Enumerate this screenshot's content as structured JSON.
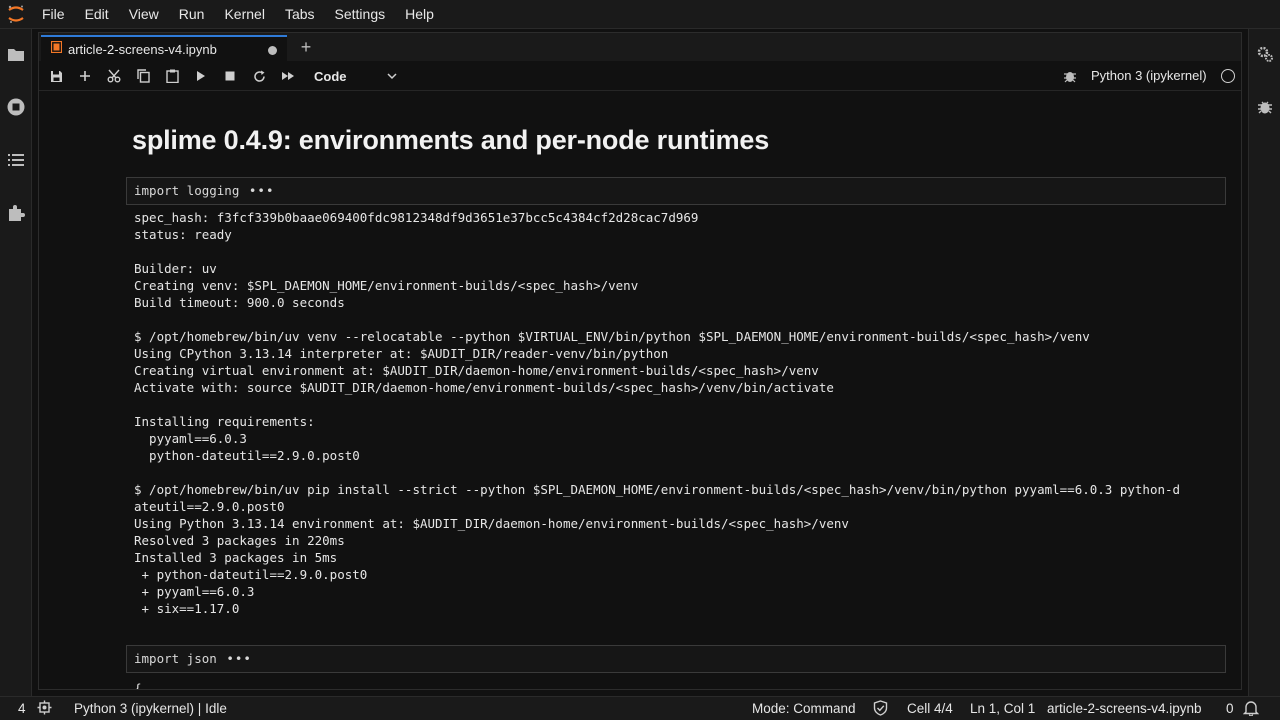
{
  "menu": [
    "File",
    "Edit",
    "View",
    "Run",
    "Kernel",
    "Tabs",
    "Settings",
    "Help"
  ],
  "tab": {
    "label": "article-2-screens-v4.ipynb",
    "add": "+"
  },
  "toolbar": {
    "cell_type": "Code",
    "kernel": "Python 3 (ipykernel)"
  },
  "notebook": {
    "heading": "splime 0.4.9: environments and per-node runtimes",
    "cell1_code": "import logging",
    "cell1_collapsed": "•••",
    "output_lines": [
      "spec_hash: f3fcf339b0baae069400fdc9812348df9d3651e37bcc5c4384cf2d28cac7d969",
      "status: ready",
      "",
      "Builder: uv",
      "Creating venv: $SPL_DAEMON_HOME/environment-builds/<spec_hash>/venv",
      "Build timeout: 900.0 seconds",
      "",
      "$ /opt/homebrew/bin/uv venv --relocatable --python $VIRTUAL_ENV/bin/python $SPL_DAEMON_HOME/environment-builds/<spec_hash>/venv",
      "Using CPython 3.13.14 interpreter at: $AUDIT_DIR/reader-venv/bin/python",
      "Creating virtual environment at: $AUDIT_DIR/daemon-home/environment-builds/<spec_hash>/venv",
      "Activate with: source $AUDIT_DIR/daemon-home/environment-builds/<spec_hash>/venv/bin/activate",
      "",
      "Installing requirements:",
      "  pyyaml==6.0.3",
      "  python-dateutil==2.9.0.post0",
      "",
      "$ /opt/homebrew/bin/uv pip install --strict --python $SPL_DAEMON_HOME/environment-builds/<spec_hash>/venv/bin/python pyyaml==6.0.3 python-d",
      "ateutil==2.9.0.post0",
      "Using Python 3.13.14 environment at: $AUDIT_DIR/daemon-home/environment-builds/<spec_hash>/venv",
      "Resolved 3 packages in 220ms",
      "Installed 3 packages in 5ms",
      " + python-dateutil==2.9.0.post0",
      " + pyyaml==6.0.3",
      " + six==1.17.0"
    ],
    "cell2_code": "import json",
    "cell2_collapsed": "•••",
    "cell2_output_first": "{"
  },
  "status": {
    "terminals": "4",
    "kernel_state": "Python 3 (ipykernel) | Idle",
    "mode": "Mode: Command",
    "cell": "Cell 4/4",
    "position": "Ln 1, Col 1",
    "file": "article-2-screens-v4.ipynb",
    "notifications": "0"
  }
}
